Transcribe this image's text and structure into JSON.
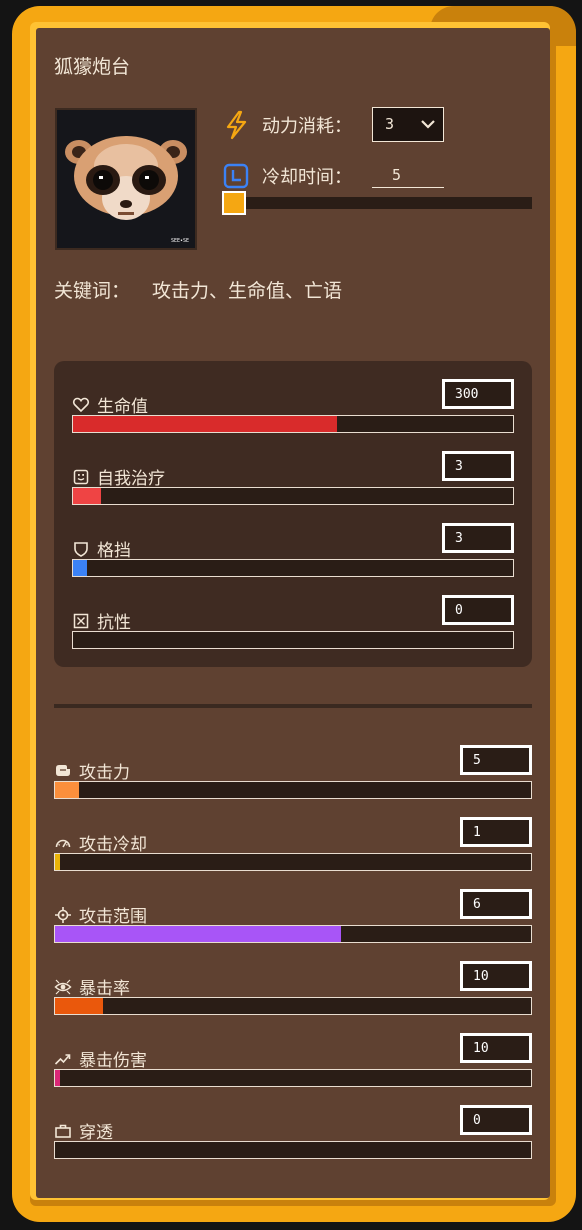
{
  "card": {
    "title": "狐獴炮台",
    "power_cost_label": "动力消耗：",
    "power_cost_value": "3",
    "cooldown_label": "冷却时间：",
    "cooldown_value": "5",
    "cooldown_slider_fraction": 0,
    "keywords_label": "关键词：",
    "keywords_value": "攻击力、生命值、亡语",
    "portrait_caption": "SEE•SE",
    "colors": {
      "frame": "#f5a712",
      "panel": "#5f4131",
      "dark_box": "#3f2b22"
    }
  },
  "defense_stats": [
    {
      "key": "hp",
      "icon": "heart-icon",
      "label": "生命值",
      "value": "300",
      "fill_fraction": 0.6,
      "color": "#d92b2b"
    },
    {
      "key": "heal",
      "icon": "smile-icon",
      "label": "自我治疗",
      "value": "3",
      "fill_fraction": 0.063,
      "color": "#ef4444"
    },
    {
      "key": "block",
      "icon": "shield-icon",
      "label": "格挡",
      "value": "3",
      "fill_fraction": 0.032,
      "color": "#3b82f6"
    },
    {
      "key": "resist",
      "icon": "resist-icon",
      "label": "抗性",
      "value": "0",
      "fill_fraction": 0,
      "color": "#9ca3af"
    }
  ],
  "attack_stats": [
    {
      "key": "atk",
      "icon": "fist-icon",
      "label": "攻击力",
      "value": "5",
      "fill_fraction": 0.05,
      "color": "#fb8f3c"
    },
    {
      "key": "atk_cd",
      "icon": "gauge-icon",
      "label": "攻击冷却",
      "value": "1",
      "fill_fraction": 0.01,
      "color": "#eab308"
    },
    {
      "key": "range",
      "icon": "crosshair-icon",
      "label": "攻击范围",
      "value": "6",
      "fill_fraction": 0.6,
      "color": "#a855f7"
    },
    {
      "key": "crit_rate",
      "icon": "eye-icon",
      "label": "暴击率",
      "value": "10",
      "fill_fraction": 0.1,
      "color": "#ea580c"
    },
    {
      "key": "crit_dmg",
      "icon": "trend-icon",
      "label": "暴击伤害",
      "value": "10",
      "fill_fraction": 0.01,
      "color": "#db2777"
    },
    {
      "key": "pierce",
      "icon": "briefcase-icon",
      "label": "穿透",
      "value": "0",
      "fill_fraction": 0,
      "color": "#9ca3af"
    }
  ]
}
